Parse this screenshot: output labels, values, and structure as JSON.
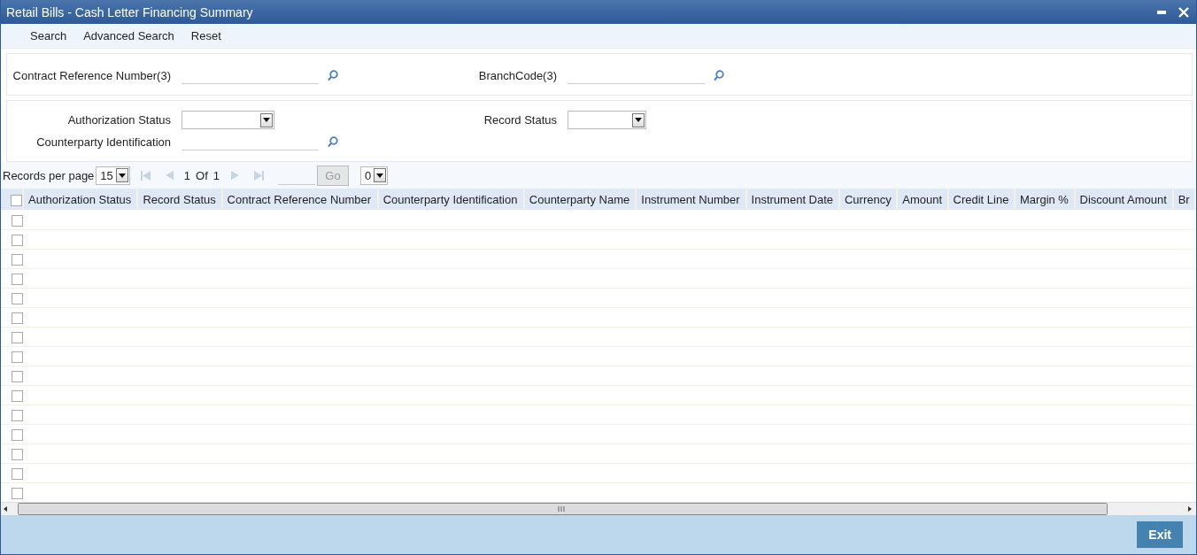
{
  "window": {
    "title": "Retail Bills - Cash Letter Financing Summary"
  },
  "toolbar": [
    "Search",
    "Advanced Search",
    "Reset"
  ],
  "panels": [
    {
      "fields": [
        {
          "kind": "lookup",
          "label": "Contract Reference Number(3)"
        },
        {
          "kind": "lookup",
          "label": "BranchCode(3)"
        }
      ]
    },
    {
      "fields": [
        {
          "kind": "select",
          "label": "Authorization Status"
        },
        {
          "kind": "select",
          "label": "Record Status"
        },
        {
          "kind": "lookup",
          "label": "Counterparty Identification"
        }
      ]
    }
  ],
  "pager": {
    "label": "Records per page",
    "per_page": "15",
    "page": "1",
    "of": "Of",
    "total": "1",
    "go": {
      "label": "Go",
      "disabled": true
    },
    "option": "0"
  },
  "table": {
    "select_all": {
      "checked": false
    },
    "columns": [
      "Authorization Status",
      "Record Status",
      "Contract Reference Number",
      "Counterparty Identification",
      "Counterparty Name",
      "Instrument Number",
      "Instrument Date",
      "Currency",
      "Amount",
      "Credit Line",
      "Margin %",
      "Discount Amount",
      "Br"
    ],
    "rows": [
      {
        "selected": false
      },
      {
        "selected": false
      },
      {
        "selected": false
      },
      {
        "selected": false
      },
      {
        "selected": false
      },
      {
        "selected": false
      },
      {
        "selected": false
      },
      {
        "selected": false
      },
      {
        "selected": false
      },
      {
        "selected": false
      },
      {
        "selected": false
      },
      {
        "selected": false
      },
      {
        "selected": false
      },
      {
        "selected": false
      },
      {
        "selected": false
      }
    ]
  },
  "buttons": [
    "Exit"
  ]
}
